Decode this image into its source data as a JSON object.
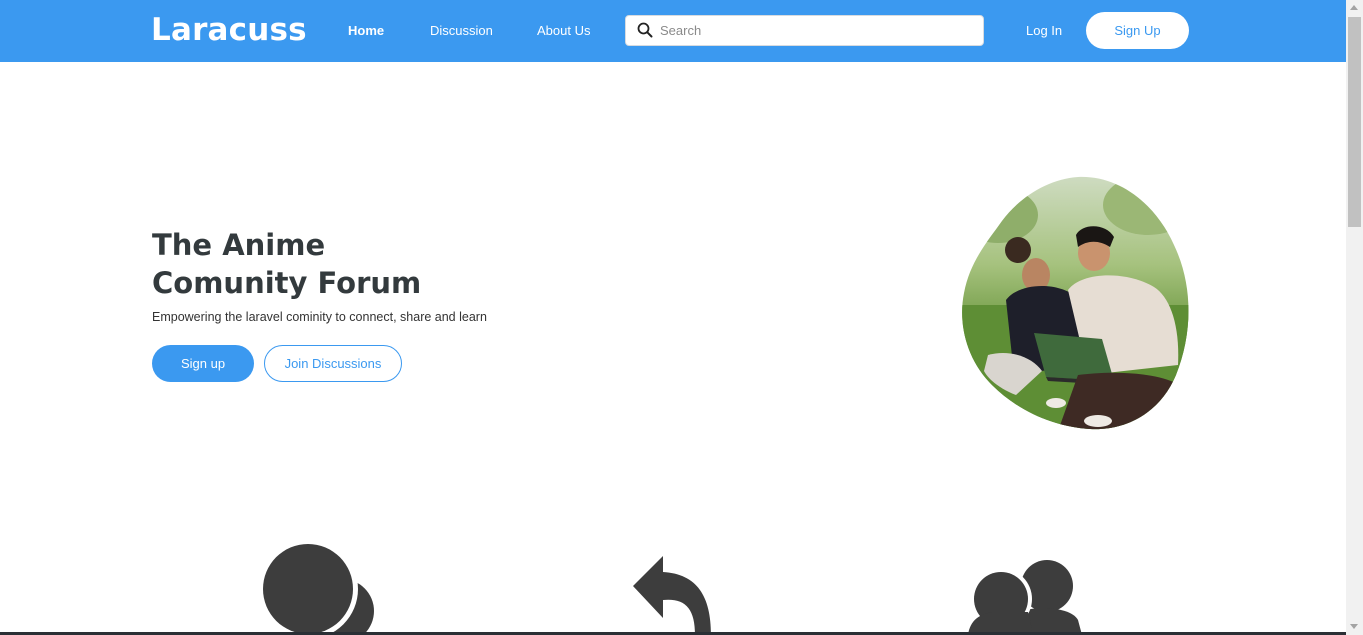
{
  "navbar": {
    "brand": "Laracuss",
    "links": [
      {
        "label": "Home",
        "active": true
      },
      {
        "label": "Discussion",
        "active": false
      },
      {
        "label": "About Us",
        "active": false
      }
    ],
    "search": {
      "placeholder": "Search",
      "value": ""
    },
    "login_label": "Log In",
    "signup_label": "Sign Up"
  },
  "hero": {
    "title_line1": "The Anime",
    "title_line2": "Comunity Forum",
    "subtitle": "Empowering the laravel cominity to connect, share and learn",
    "primary_button": "Sign up",
    "secondary_button": "Join Discussions"
  },
  "features": {
    "icons": [
      "chat-bubbles-icon",
      "reply-arrow-icon",
      "users-icon"
    ]
  },
  "colors": {
    "brand": "#3b99f0",
    "heading": "#333a3d",
    "icon": "#3d3d3d"
  }
}
